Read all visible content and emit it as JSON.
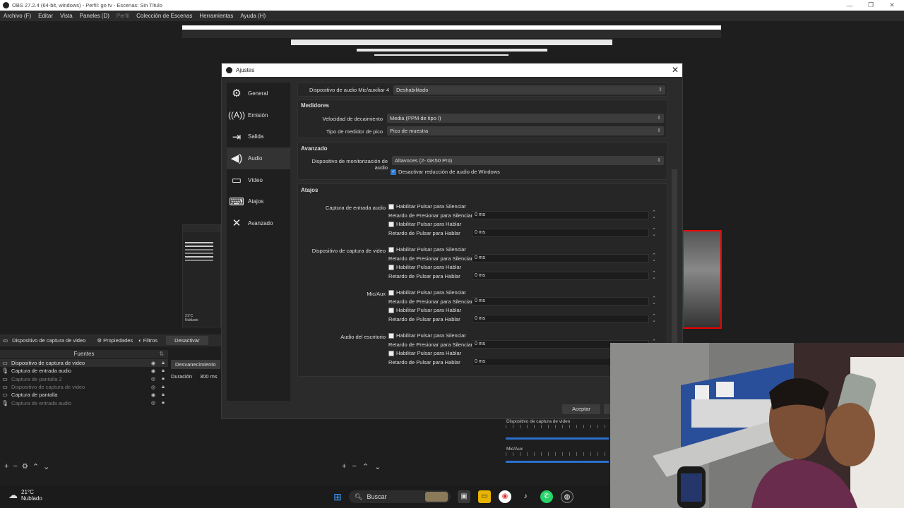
{
  "window": {
    "title": "OBS 27.2.4 (64-bit, windows) - Perfil: go tv - Escenas: Sin Título",
    "minimize": "—",
    "maximize": "❐",
    "close": "✕"
  },
  "menu": [
    "Archivo (F)",
    "Editar",
    "Vista",
    "Paneles (D)",
    "Perfil",
    "Colección de Escenas",
    "Herramientas",
    "Ayuda (H)"
  ],
  "source_toolbar": {
    "selected_source": "Dispositivo de captura de video",
    "properties": "Propiedades",
    "filters": "Filtros",
    "deactivate": "Desactivar"
  },
  "sources": {
    "header": "Fuentes",
    "items": [
      {
        "name": "Dispositivo de captura de video",
        "icon": "camera-icon",
        "dim": false
      },
      {
        "name": "Captura de entrada audio",
        "icon": "mic-icon",
        "dim": false
      },
      {
        "name": "Captura de pantalla 2",
        "icon": "monitor-icon",
        "dim": true
      },
      {
        "name": "Dispositivo de captura de video",
        "icon": "camera-icon",
        "dim": true
      },
      {
        "name": "Captura de pantalla",
        "icon": "monitor-icon",
        "dim": false
      },
      {
        "name": "Captura de entrada audio",
        "icon": "mic-icon",
        "dim": true
      }
    ]
  },
  "transitions": {
    "fade": "Desvanecimiento",
    "duration_label": "Duración",
    "duration_value": "300 ms"
  },
  "mixer": {
    "tracks": [
      "Dispositivo de captura de video",
      "Mic/Aux"
    ]
  },
  "settings": {
    "title": "Ajustes",
    "close": "✕",
    "nav": [
      {
        "label": "General",
        "icon": "gear-icon",
        "glyph": "⚙"
      },
      {
        "label": "Emisión",
        "icon": "broadcast-icon",
        "glyph": "📡"
      },
      {
        "label": "Salida",
        "icon": "output-icon",
        "glyph": "⇥"
      },
      {
        "label": "Audio",
        "icon": "speaker-icon",
        "glyph": "🔊"
      },
      {
        "label": "Vídeo",
        "icon": "monitor-icon",
        "glyph": "🖵"
      },
      {
        "label": "Atajos",
        "icon": "keyboard-icon",
        "glyph": "⌨"
      },
      {
        "label": "Avanzado",
        "icon": "tools-icon",
        "glyph": "🛠"
      }
    ],
    "active_nav": "Audio",
    "mic_aux4_label": "Dispositivo de audio Mic/auxiliar 4",
    "mic_aux4_value": "Deshabilitado",
    "meters": {
      "header": "Medidores",
      "decay_label": "Velocidad de decaimiento",
      "decay_value": "Media (PPM de tipo I)",
      "peak_label": "Tipo de medidor de pico",
      "peak_value": "Pico de muestra"
    },
    "advanced": {
      "header": "Avanzado",
      "monitor_label": "Dispositivo de monitorización de audio",
      "monitor_value": "Altavoces (2- GK50 Pro)",
      "ducking_label": "Desactivar reducción de audio de Windows"
    },
    "hotkeys": {
      "header": "Atajos",
      "enable_mute": "Habilitar Pulsar para Silenciar",
      "mute_delay": "Retardo de Presionar para Silenciar",
      "enable_talk": "Habilitar Pulsar para Hablar",
      "talk_delay": "Retardo de Pulsar para Hablar",
      "zero": "0 ms",
      "sources": [
        "Captura de entrada audio",
        "Dispositivo de captura de video",
        "Mic/Aux",
        "Audio del escritorio"
      ]
    },
    "accept": "Aceptar"
  },
  "taskbar": {
    "temp": "21°C",
    "weather": "Nublado",
    "search": "Buscar"
  },
  "scene_thumb": {
    "weather_temp": "21°C",
    "weather_text": "Nublado"
  }
}
